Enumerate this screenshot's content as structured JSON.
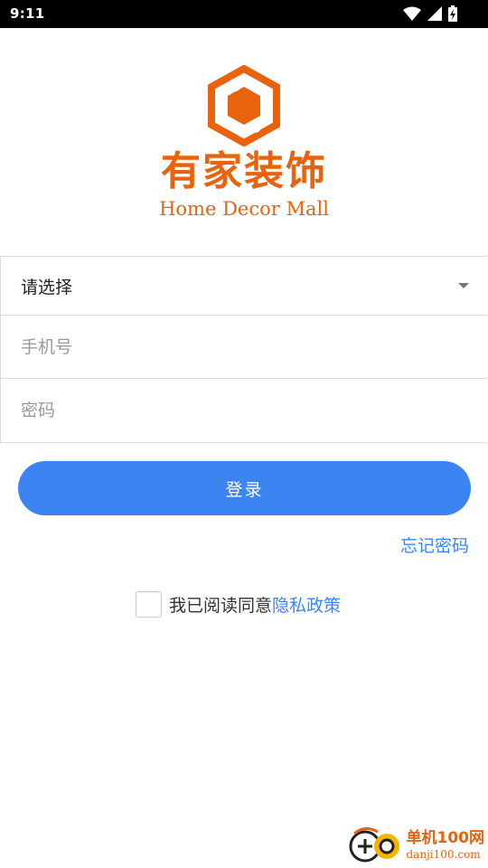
{
  "status_bar": {
    "time": "9:11",
    "icons": [
      "wifi-icon",
      "signal-icon",
      "battery-charging-icon"
    ]
  },
  "logo": {
    "name_cn": "有家装饰",
    "name_en": "Home Decor Mall",
    "color": "#e9620e"
  },
  "form": {
    "select": {
      "value": "请选择"
    },
    "phone": {
      "placeholder": "手机号",
      "value": ""
    },
    "password": {
      "placeholder": "密码",
      "value": ""
    }
  },
  "actions": {
    "login_label": "登录",
    "forgot_label": "忘记密码",
    "accent_color": "#3d84f3"
  },
  "agreement": {
    "checked": false,
    "text": "我已阅读同意",
    "policy_label": "隐私政策"
  },
  "watermark": {
    "name": "单机100网",
    "url": "danji100.com"
  }
}
